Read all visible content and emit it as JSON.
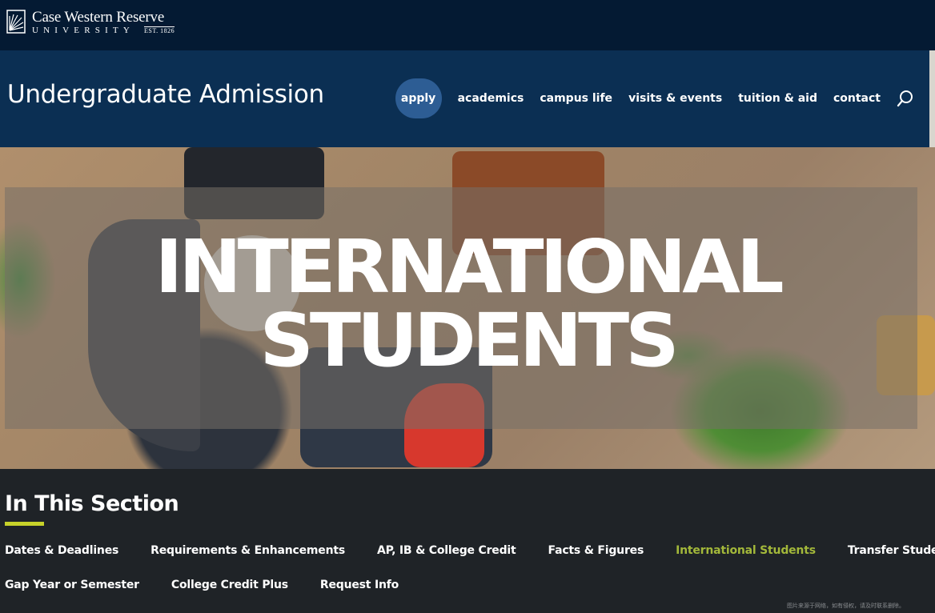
{
  "brand": {
    "name": "Case Western Reserve",
    "sub": "University",
    "est": "EST. 1826"
  },
  "site_title": "Undergraduate Admission",
  "nav": {
    "items": [
      {
        "label": "apply",
        "active": true
      },
      {
        "label": "academics"
      },
      {
        "label": "campus life"
      },
      {
        "label": "visits & events"
      },
      {
        "label": "tuition & aid"
      },
      {
        "label": "contact"
      }
    ],
    "search_icon": "search-icon"
  },
  "hero": {
    "title_line1": "INTERNATIONAL",
    "title_line2": "STUDENTS"
  },
  "section": {
    "title": "In This Section",
    "accent_color": "#c7d22a",
    "current_color": "#a3b83a",
    "row1": [
      "Dates & Deadlines",
      "Requirements & Enhancements",
      "AP, IB & College Credit",
      "Facts & Figures",
      "International Students",
      "Transfer Students"
    ],
    "row2": [
      "Gap Year or Semester",
      "College Credit Plus",
      "Request Info"
    ],
    "current": "International Students"
  },
  "watermark": "图片来源于网络，如有侵权，请及时联系删除。"
}
